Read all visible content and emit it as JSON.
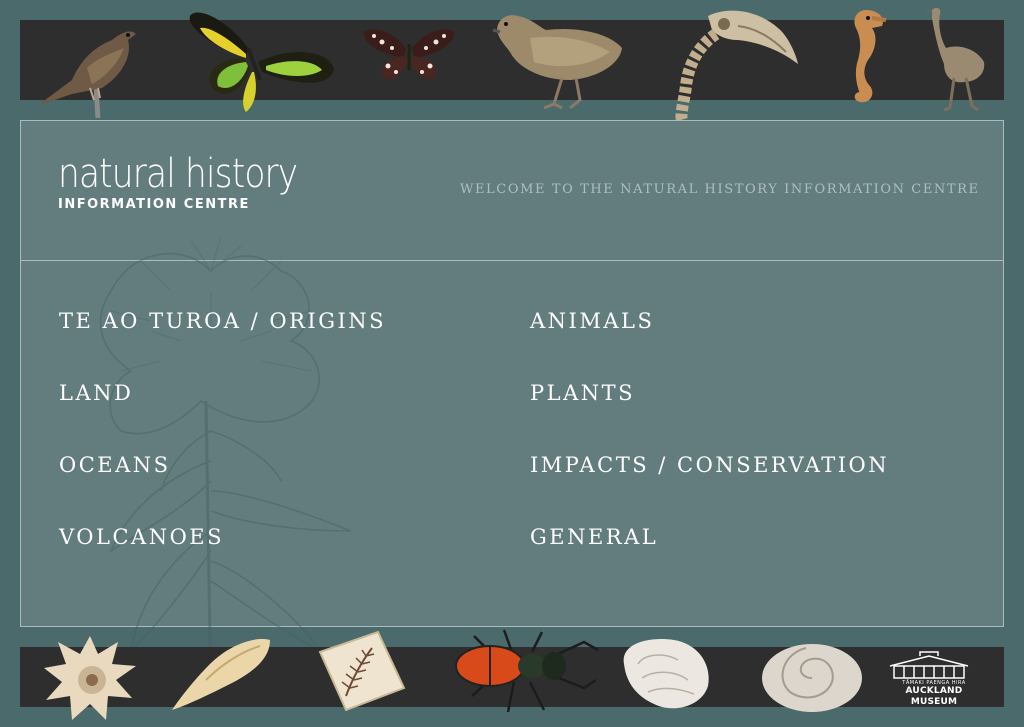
{
  "logo": {
    "title": "natural history",
    "subtitle": "INFORMATION CENTRE"
  },
  "welcome": "WELCOME TO THE NATURAL HISTORY INFORMATION CENTRE",
  "nav": {
    "left": [
      "TE AO TUROA / ORIGINS",
      "LAND",
      "OCEANS",
      "VOLCANOES"
    ],
    "right": [
      "ANIMALS",
      "PLANTS",
      "IMPACTS / CONSERVATION",
      "GENERAL"
    ]
  },
  "museum": {
    "small": "TĀMAKI PAENGA HIRA",
    "name": "AUCKLAND MUSEUM"
  },
  "colors": {
    "background": "#4a6a6c",
    "panel": "#637c7e",
    "strip": "#2e2e2e",
    "text": "#ffffff"
  },
  "specimens": {
    "top": [
      "bird-icon",
      "green-butterfly-icon",
      "brown-butterfly-icon",
      "quail-icon",
      "skeleton-icon",
      "seahorse-icon",
      "moa-icon"
    ],
    "bottom": [
      "spiky-shell-icon",
      "cone-shell-icon",
      "fern-book-icon",
      "stag-beetle-icon",
      "nautilus-shell-icon",
      "snail-shell-icon"
    ]
  }
}
